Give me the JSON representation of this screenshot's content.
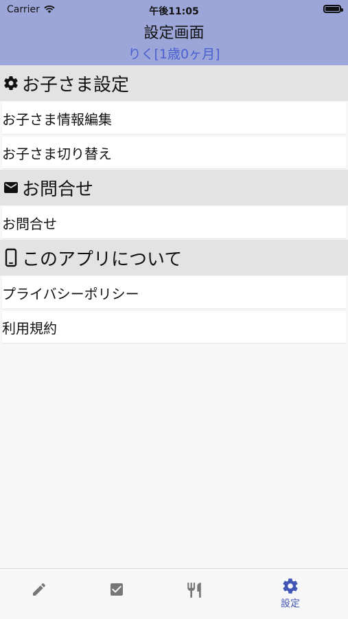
{
  "status_bar": {
    "carrier": "Carrier",
    "time": "午後11:05"
  },
  "header": {
    "title": "設定画面",
    "subtitle": "りく[1歳0ヶ月]"
  },
  "sections": [
    {
      "title": "お子さま設定",
      "icon": "gear-icon",
      "items": [
        "お子さま情報編集",
        "お子さま切り替え"
      ]
    },
    {
      "title": "お問合せ",
      "icon": "mail-icon",
      "items": [
        "お問合せ"
      ]
    },
    {
      "title": "このアプリについて",
      "icon": "phone-icon",
      "items": [
        "プライバシーポリシー",
        "利用規約"
      ]
    }
  ],
  "tabbar": {
    "tabs": [
      {
        "icon": "pencil-icon",
        "label": ""
      },
      {
        "icon": "checkbox-icon",
        "label": ""
      },
      {
        "icon": "cutlery-icon",
        "label": ""
      },
      {
        "icon": "gear-icon",
        "label": "設定",
        "active": true
      }
    ],
    "active_color": "#4256b8",
    "inactive_color": "#777777"
  },
  "colors": {
    "header_bg": "#9ca6d8",
    "subtitle": "#4a5fd0",
    "section_bg": "#e3e3e3"
  }
}
